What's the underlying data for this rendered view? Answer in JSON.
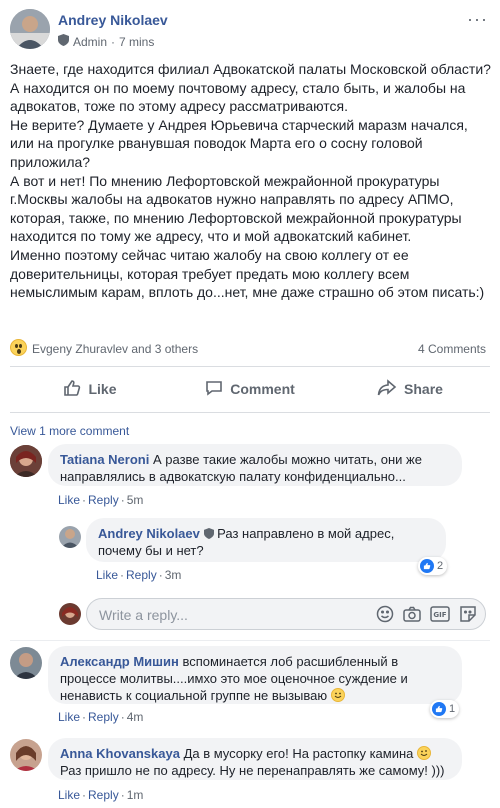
{
  "post": {
    "author": "Andrey Nikolaev",
    "role": "Admin",
    "time": "7 mins",
    "more_label": "···",
    "paragraphs": [
      "Знаете, где находится филиал Адвокатской палаты Московской области? А находится он по моему почтовому адресу, стало быть, и жалобы на адвокатов, тоже по этому адресу рассматриваются.",
      "Не верите? Думаете у Андрея Юрьевича старческий маразм начался, или на прогулке рванувшая поводок Марта его о сосну головой приложила?",
      "А вот и нет! По мнению Лефортовской межрайонной прокуратуры г.Москвы жалобы на адвокатов нужно направлять по адресу АПМО, которая, также, по мнению Лефортовской межрайонной прокуратуры находится по тому же адресу, что и мой адвокатский кабинет.",
      "Именно поэтому сейчас читаю жалобу на свою коллегу от ее доверительницы, которая требует предать мою коллегу всем немыслимым карам, вплоть до...нет, мне даже страшно об этом писать:)"
    ]
  },
  "reactions": {
    "summary": "Evgeny Zhuravlev and 3 others",
    "comments_count": "4 Comments"
  },
  "actions": {
    "like": "Like",
    "comment": "Comment",
    "share": "Share"
  },
  "view_more": "View 1 more comment",
  "comments": [
    {
      "author": "Tatiana Neroni",
      "text_1": "А разве такие жалобы можно читать, они же",
      "text_2": "направлялись в адвокатскую палату конфиденциально...",
      "like": "Like",
      "reply": "Reply",
      "time": "5m"
    },
    {
      "author": "Andrey Nikolaev",
      "text_1": "Раз направлено в мой адрес,",
      "text_2": "почему бы и нет?",
      "like": "Like",
      "reply": "Reply",
      "time": "3m",
      "like_count": "2"
    },
    {
      "author": "Александр Мишин",
      "text_1": "вспоминается лоб расшибленный в",
      "text_2": "процессе молитвы....имхо это мое оценочное суждение и",
      "text_3": "ненависть к социальной группе не вызываю",
      "like": "Like",
      "reply": "Reply",
      "time": "4m",
      "like_count": "1"
    },
    {
      "author": "Anna Khovanskaya",
      "text_1": "Да в мусорку его! На растопку камина",
      "text_2": "Раз пришло не по адресу. Ну не перенаправлять же самому! )))",
      "like": "Like",
      "reply": "Reply",
      "time": "1m"
    }
  ],
  "reply_box": {
    "placeholder": "Write a reply..."
  },
  "colors": {
    "link": "#385898",
    "secondary": "#606770",
    "bubble": "#f2f3f5",
    "like_blue": "#2078f4"
  },
  "icons": [
    "shield-icon",
    "more-icon",
    "wow-reaction-icon",
    "like-icon",
    "comment-icon",
    "share-icon",
    "smile-emoji-icon",
    "camera-icon",
    "gif-icon",
    "sticker-icon",
    "like-badge-icon"
  ]
}
